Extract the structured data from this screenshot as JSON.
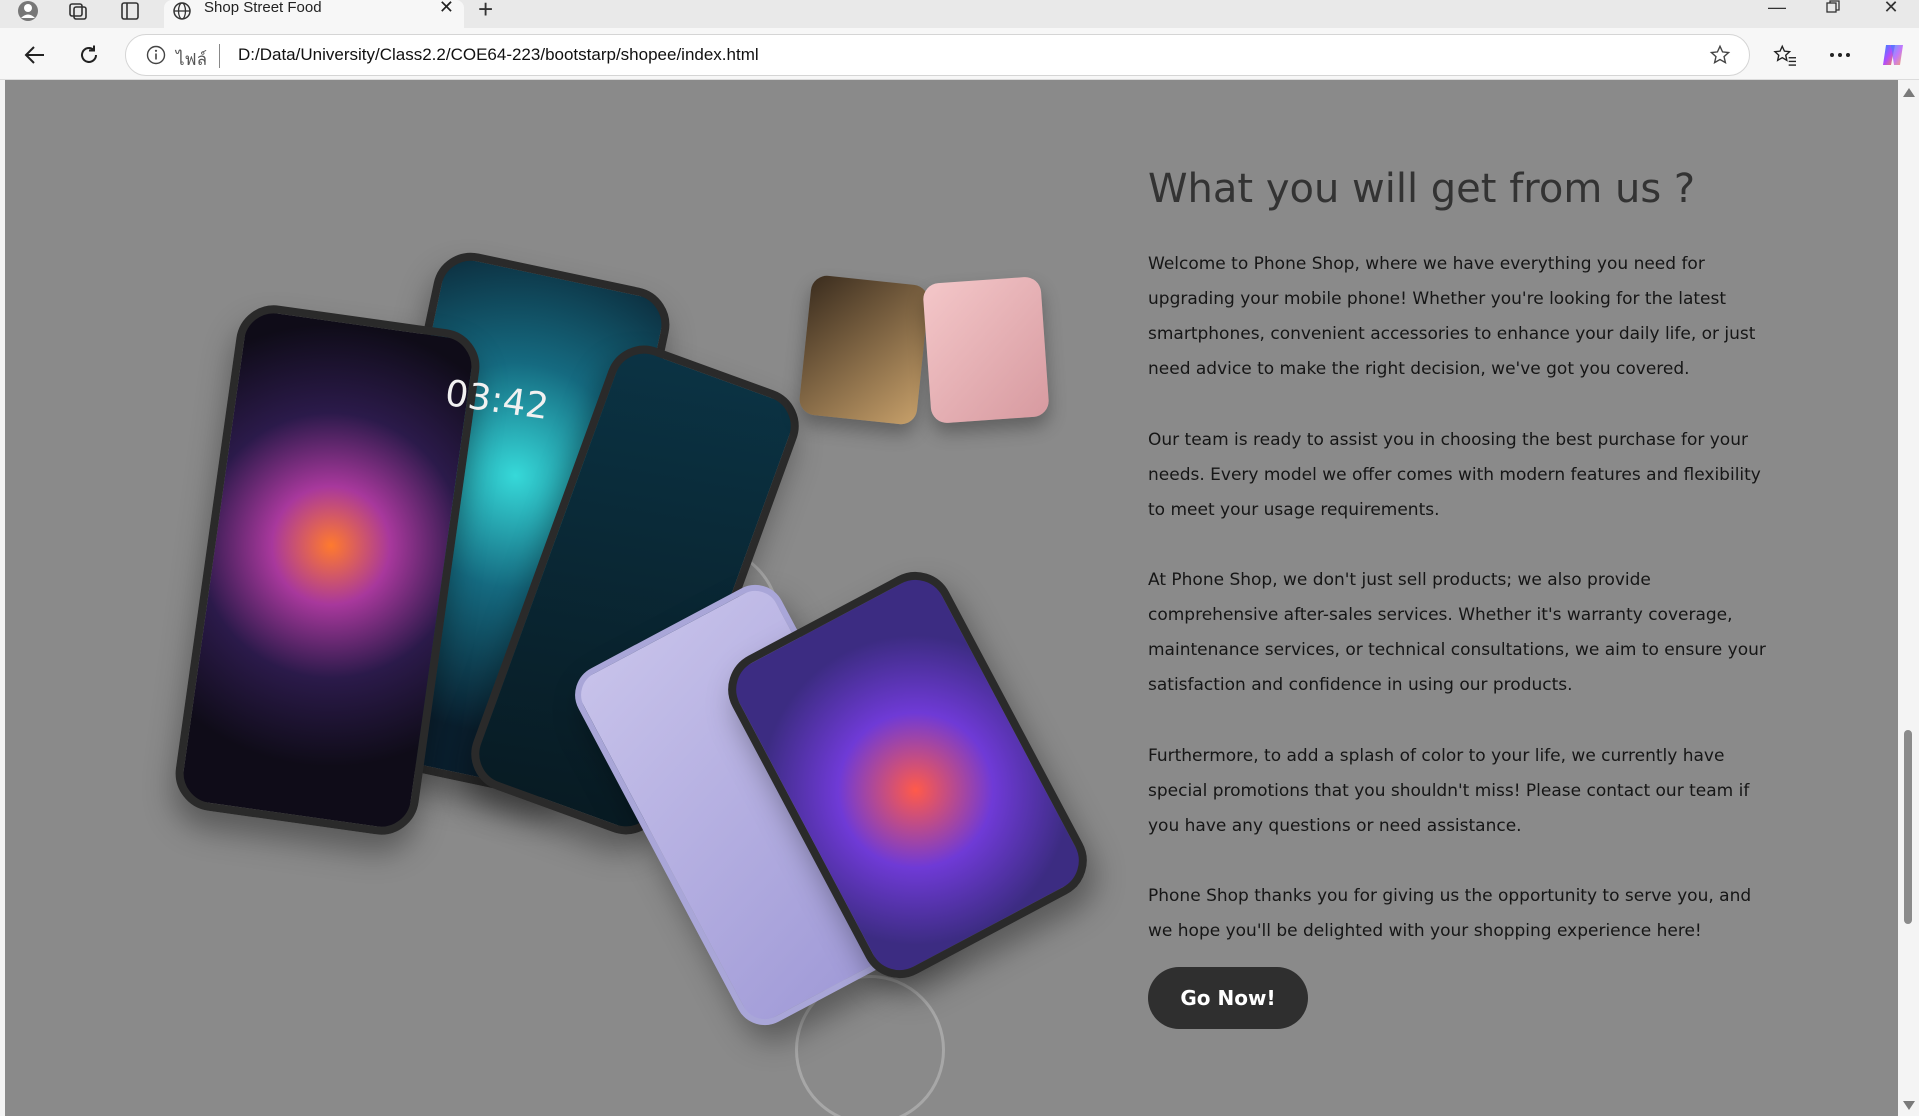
{
  "browser": {
    "tab_title": "Shop Street Food",
    "address_prefix": "ไฟล์",
    "url": "D:/Data/University/Class2.2/COE64-223/bootstarp/shopee/index.html"
  },
  "icons": {
    "profile": "profile-icon",
    "workspaces": "workspaces-icon",
    "tab_actions": "tab-actions-icon",
    "globe": "globe-icon",
    "close": "close-icon",
    "new_tab": "plus-icon",
    "minimize": "minimize-icon",
    "restore": "restore-icon",
    "window_close": "window-close-icon",
    "back": "back-arrow-icon",
    "refresh": "refresh-icon",
    "info": "info-icon",
    "favorite": "star-icon",
    "favorites": "favorites-icon",
    "more": "more-icon",
    "copilot": "copilot-icon"
  },
  "page": {
    "headline": "What you will get from us ?",
    "paragraphs": [
      "Welcome to Phone Shop, where we have everything you need for upgrading your mobile phone! Whether you're looking for the latest smartphones, convenient accessories to enhance your daily life, or just need advice to make the right decision, we've got you covered.",
      "Our team is ready to assist you in choosing the best purchase for your needs. Every model we offer comes with modern features and flexibility to meet your usage requirements.",
      "At Phone Shop, we don't just sell products; we also provide comprehensive after-sales services. Whether it's warranty coverage, maintenance services, or technical consultations, we aim to ensure your satisfaction and confidence in using our products.",
      "Furthermore, to add a splash of color to your life, we currently have special promotions that you shouldn't miss! Please contact our team if you have any questions or need assistance.",
      "Phone Shop thanks you for giving us the opportunity to serve you, and we hope you'll be delighted with your shopping experience here!"
    ],
    "cta_label": "Go Now!",
    "hero_clock": "03:42"
  },
  "colors": {
    "page_background": "#8a8a8a",
    "headline": "#333333",
    "button": "#2f2f2f",
    "button_text": "#ffffff"
  }
}
